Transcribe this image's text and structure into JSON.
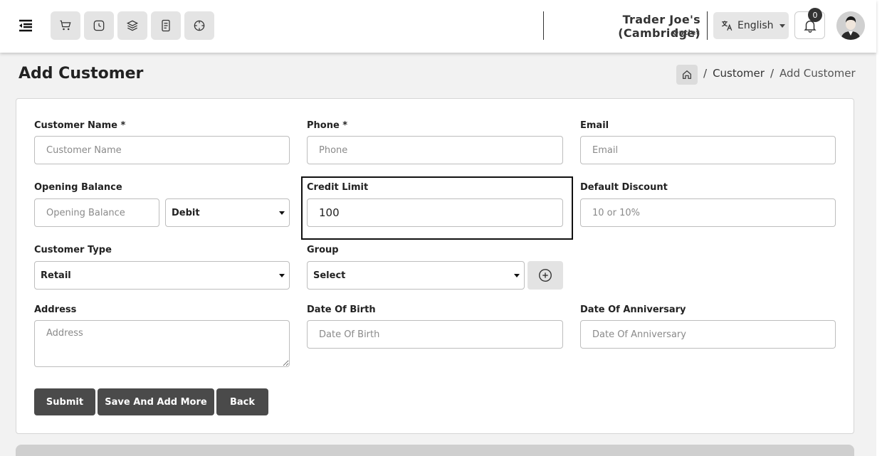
{
  "topbar": {
    "quick_icons": [
      "cart-icon",
      "clock-icon",
      "stack-icon",
      "receipt-icon",
      "dashboard-icon"
    ],
    "store_name": "Trader Joe's (Cambridge)",
    "store_type": "Outlet",
    "language": "English",
    "notification_count": "0"
  },
  "header": {
    "title": "Add Customer",
    "breadcrumb": [
      "Customer",
      "Add Customer"
    ],
    "separator": "/"
  },
  "form": {
    "customer_name": {
      "label": "Customer Name *",
      "placeholder": "Customer Name",
      "value": ""
    },
    "phone": {
      "label": "Phone *",
      "placeholder": "Phone",
      "value": ""
    },
    "email": {
      "label": "Email",
      "placeholder": "Email",
      "value": ""
    },
    "opening_balance": {
      "label": "Opening Balance",
      "placeholder": "Opening Balance",
      "value": "",
      "type_selected": "Debit"
    },
    "credit_limit": {
      "label": "Credit Limit",
      "placeholder": "Credit Limit",
      "value": "100"
    },
    "default_discount": {
      "label": "Default Discount",
      "placeholder": "10 or 10%",
      "value": ""
    },
    "customer_type": {
      "label": "Customer Type",
      "selected": "Retail"
    },
    "group": {
      "label": "Group",
      "selected": "Select"
    },
    "address": {
      "label": "Address",
      "placeholder": "Address",
      "value": ""
    },
    "date_of_birth": {
      "label": "Date Of Birth",
      "placeholder": "Date Of Birth",
      "value": ""
    },
    "date_of_anniversary": {
      "label": "Date Of Anniversary",
      "placeholder": "Date Of Anniversary",
      "value": ""
    }
  },
  "buttons": {
    "submit": "Submit",
    "save_add_more": "Save And Add More",
    "back": "Back"
  },
  "colors": {
    "primary_button": "#4a4a4a",
    "highlight_border": "#111111"
  }
}
